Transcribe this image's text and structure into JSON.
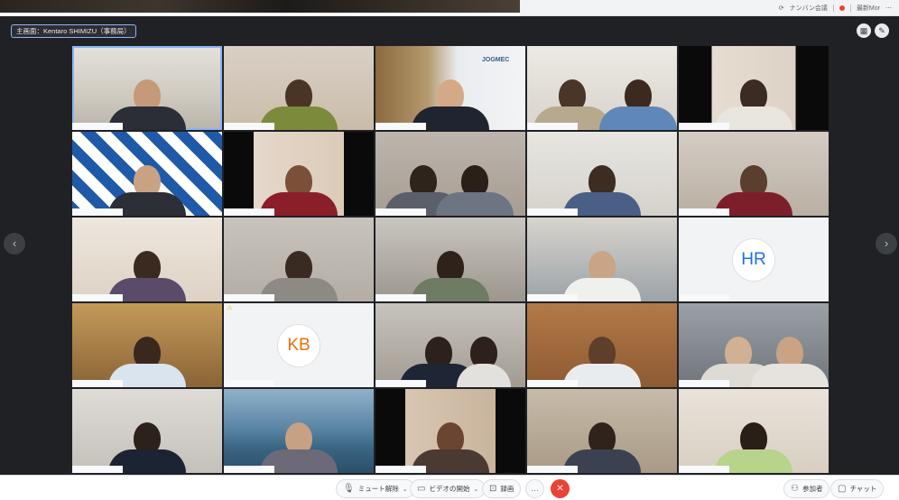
{
  "topbar": {
    "status_text": "ナンバン会議",
    "user_text": "最新Mor",
    "more_icon": "more-icon"
  },
  "meeting": {
    "active_speaker": "主画面：Kentaro SHIMIZU（事務局）",
    "layout_button_icon": "grid-icon",
    "pin_button_icon": "pin-icon",
    "prev_page_icon": "chevron-left-icon",
    "next_page_icon": "chevron-right-icon",
    "tiles": [
      {
        "id": 1,
        "type": "video",
        "active": true
      },
      {
        "id": 2,
        "type": "video"
      },
      {
        "id": 3,
        "type": "video",
        "logo": "JOGMEC"
      },
      {
        "id": 4,
        "type": "video"
      },
      {
        "id": 5,
        "type": "video"
      },
      {
        "id": 6,
        "type": "video"
      },
      {
        "id": 7,
        "type": "video"
      },
      {
        "id": 8,
        "type": "video"
      },
      {
        "id": 9,
        "type": "video"
      },
      {
        "id": 10,
        "type": "video"
      },
      {
        "id": 11,
        "type": "video"
      },
      {
        "id": 12,
        "type": "video"
      },
      {
        "id": 13,
        "type": "video"
      },
      {
        "id": 14,
        "type": "video"
      },
      {
        "id": 15,
        "type": "avatar",
        "initials": "HR",
        "color": "#1a73e8"
      },
      {
        "id": 16,
        "type": "video"
      },
      {
        "id": 17,
        "type": "avatar",
        "initials": "KB",
        "color": "#e8710a"
      },
      {
        "id": 18,
        "type": "video"
      },
      {
        "id": 19,
        "type": "video"
      },
      {
        "id": 20,
        "type": "video"
      },
      {
        "id": 21,
        "type": "video"
      },
      {
        "id": 22,
        "type": "video"
      },
      {
        "id": 23,
        "type": "video"
      },
      {
        "id": 24,
        "type": "video"
      },
      {
        "id": 25,
        "type": "video"
      }
    ]
  },
  "controls": {
    "mute_label": "ミュート解除",
    "video_label": "ビデオの開始",
    "record_label": "録画",
    "more_label": "…",
    "participants_label": "参加者",
    "chat_label": "チャット",
    "hangup_icon": "hangup-icon"
  },
  "colors": {
    "stage_bg": "#202124",
    "accent": "#8ab4f8",
    "hangup": "#ea4335"
  }
}
